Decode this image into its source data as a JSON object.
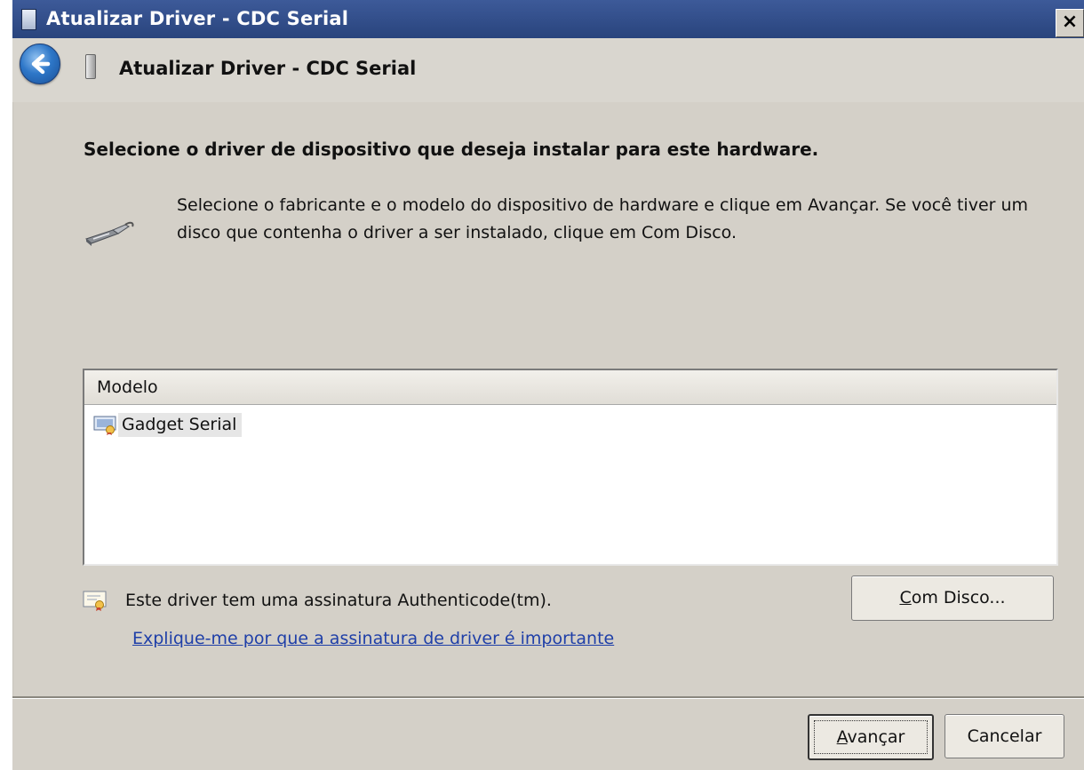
{
  "window": {
    "title": "Atualizar Driver -  CDC Serial",
    "close_label": "×"
  },
  "header": {
    "title": "Atualizar Driver -  CDC Serial"
  },
  "main": {
    "heading": "Selecione o driver de dispositivo que deseja instalar para este hardware.",
    "description": "Selecione o fabricante e o modelo do dispositivo de hardware e clique em Avançar. Se você tiver um disco que contenha o driver a ser instalado, clique em Com Disco.",
    "list": {
      "column_header": "Modelo",
      "items": [
        {
          "label": "Gadget Serial"
        }
      ]
    },
    "signature_text": "Este driver tem uma assinatura Authenticode(tm).",
    "signature_link": "Explique-me por que a assinatura de driver é importante",
    "have_disk": {
      "accel": "C",
      "rest": "om Disco..."
    }
  },
  "footer": {
    "next": {
      "accel": "A",
      "rest": "vançar"
    },
    "cancel_label": "Cancelar"
  },
  "icons": {
    "title": "device-icon",
    "back": "back-arrow-icon",
    "header": "usb-device-icon",
    "hardware": "serial-cable-icon",
    "list_item": "certificate-device-icon",
    "signature": "certificate-icon"
  },
  "colors": {
    "titlebar": "#3d5a99",
    "link": "#1f3fa8",
    "dialog_bg": "#d4d0c8"
  }
}
